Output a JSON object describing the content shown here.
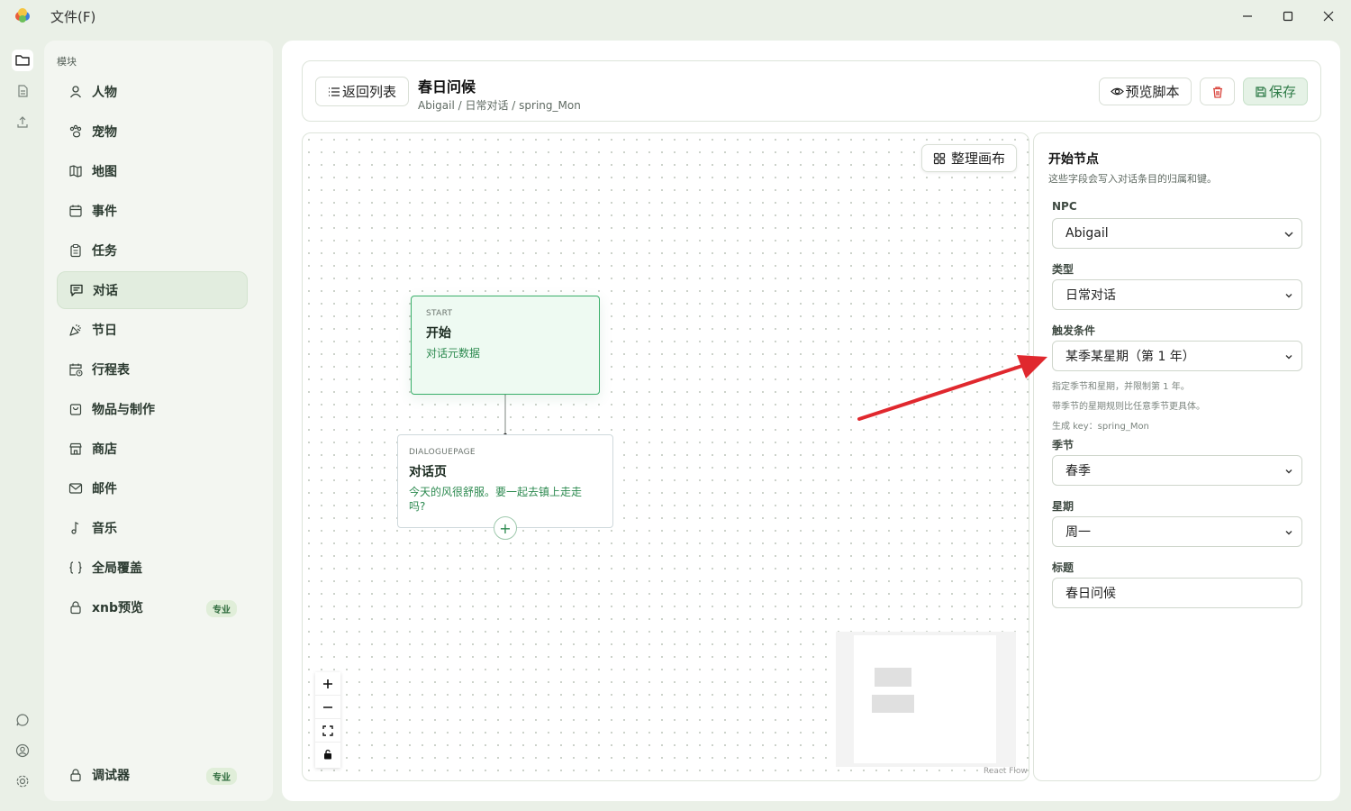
{
  "app": {
    "file_menu": "文件(F)"
  },
  "sidebar": {
    "heading": "模块",
    "items": [
      {
        "label": "人物",
        "icon": "person-icon"
      },
      {
        "label": "宠物",
        "icon": "paw-icon"
      },
      {
        "label": "地图",
        "icon": "map-icon"
      },
      {
        "label": "事件",
        "icon": "calendar-icon"
      },
      {
        "label": "任务",
        "icon": "clipboard-icon"
      },
      {
        "label": "对话",
        "icon": "message-icon",
        "active": true
      },
      {
        "label": "节日",
        "icon": "party-icon"
      },
      {
        "label": "行程表",
        "icon": "calendar-clock-icon"
      },
      {
        "label": "物品与制作",
        "icon": "bag-icon"
      },
      {
        "label": "商店",
        "icon": "store-icon"
      },
      {
        "label": "邮件",
        "icon": "mail-icon"
      },
      {
        "label": "音乐",
        "icon": "music-icon"
      },
      {
        "label": "全局覆盖",
        "icon": "braces-icon"
      },
      {
        "label": "xnb预览",
        "icon": "lock-icon",
        "badge": "专业"
      }
    ],
    "debugger": {
      "label": "调试器",
      "icon": "lock-icon",
      "badge": "专业"
    }
  },
  "header": {
    "back_button": "返回列表",
    "title": "春日问候",
    "breadcrumb": "Abigail / 日常对话 / spring_Mon",
    "preview_button": "预览脚本",
    "save_button": "保存"
  },
  "canvas": {
    "arrange_button": "整理画布",
    "attribution": "React Flow",
    "nodes": {
      "start": {
        "type": "START",
        "title": "开始",
        "desc": "对话元数据"
      },
      "page": {
        "type": "DIALOGUEPAGE",
        "title": "对话页",
        "desc": "今天的风很舒服。要一起去镇上走走吗?"
      }
    },
    "add_button": "+"
  },
  "panel": {
    "title": "开始节点",
    "subtitle": "这些字段会写入对话条目的归属和键。",
    "npc": {
      "label": "NPC",
      "value": "Abigail"
    },
    "type": {
      "label": "类型",
      "value": "日常对话"
    },
    "trigger": {
      "label": "触发条件",
      "value": "某季某星期（第 1 年）"
    },
    "hints": [
      "指定季节和星期，并限制第 1 年。",
      "带季节的星期规则比任意季节更具体。",
      "生成 key：spring_Mon"
    ],
    "season": {
      "label": "季节",
      "value": "春季"
    },
    "weekday": {
      "label": "星期",
      "value": "周一"
    },
    "title_field": {
      "label": "标题",
      "value": "春日问候"
    }
  },
  "colors": {
    "accent": "#2d8a50",
    "node_start_bg": "#eefaf2",
    "node_start_border": "#3aaf6a",
    "annotation_arrow": "#e0282e",
    "delete_red": "#d9433b"
  }
}
